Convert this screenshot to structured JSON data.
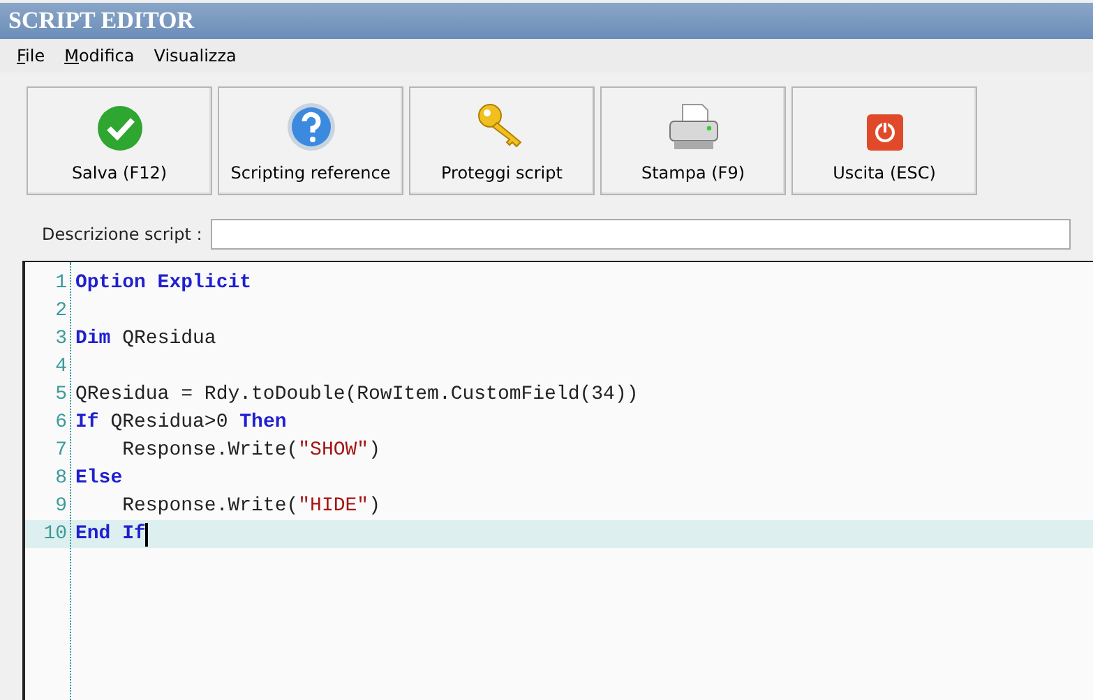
{
  "window": {
    "title": "SCRIPT EDITOR"
  },
  "menu": [
    {
      "label": "File",
      "underlined": true
    },
    {
      "label": "Modifica",
      "underlined": true
    },
    {
      "label": "Visualizza",
      "underlined": false
    }
  ],
  "toolbar": [
    {
      "kind": "check",
      "label": "Salva (F12)"
    },
    {
      "kind": "help",
      "label": "Scripting reference"
    },
    {
      "kind": "key",
      "label": "Proteggi script"
    },
    {
      "kind": "print",
      "label": "Stampa (F9)"
    },
    {
      "kind": "power",
      "label": "Uscita (ESC)"
    }
  ],
  "description": {
    "label": "Descrizione script :"
  },
  "editor": {
    "lines": [
      {
        "number": "1",
        "selected": false,
        "tokens": [
          {
            "kind": "keyword",
            "text": "Option Explicit"
          }
        ]
      },
      {
        "number": "2",
        "selected": false
      },
      {
        "number": "3",
        "selected": false,
        "tokens": [
          {
            "kind": "keyword",
            "text": "Dim"
          },
          {
            "kind": "plain",
            "text": " QResidua"
          }
        ]
      },
      {
        "number": "4",
        "selected": false
      },
      {
        "number": "5",
        "selected": false,
        "tokens": [
          {
            "kind": "plain",
            "text": "QResidua = Rdy.toDouble(RowItem.CustomField(34))"
          }
        ]
      },
      {
        "number": "6",
        "selected": false,
        "tokens": [
          {
            "kind": "keyword",
            "text": "If"
          },
          {
            "kind": "plain",
            "text": " QResidua>0 "
          },
          {
            "kind": "keyword",
            "text": "Then"
          }
        ]
      },
      {
        "number": "7",
        "selected": false,
        "tokens": [
          {
            "kind": "plain",
            "text": "    Response.Write("
          },
          {
            "kind": "string",
            "text": "\"SHOW\""
          },
          {
            "kind": "plain",
            "text": ")"
          }
        ]
      },
      {
        "number": "8",
        "selected": false,
        "tokens": [
          {
            "kind": "keyword",
            "text": "Else"
          }
        ]
      },
      {
        "number": "9",
        "selected": false,
        "tokens": [
          {
            "kind": "plain",
            "text": "    Response.Write("
          },
          {
            "kind": "string",
            "text": "\"HIDE\""
          },
          {
            "kind": "plain",
            "text": ")"
          }
        ]
      },
      {
        "number": "10",
        "selected": true,
        "tokens": [
          {
            "kind": "keyword",
            "text": "End If"
          }
        ]
      }
    ]
  }
}
